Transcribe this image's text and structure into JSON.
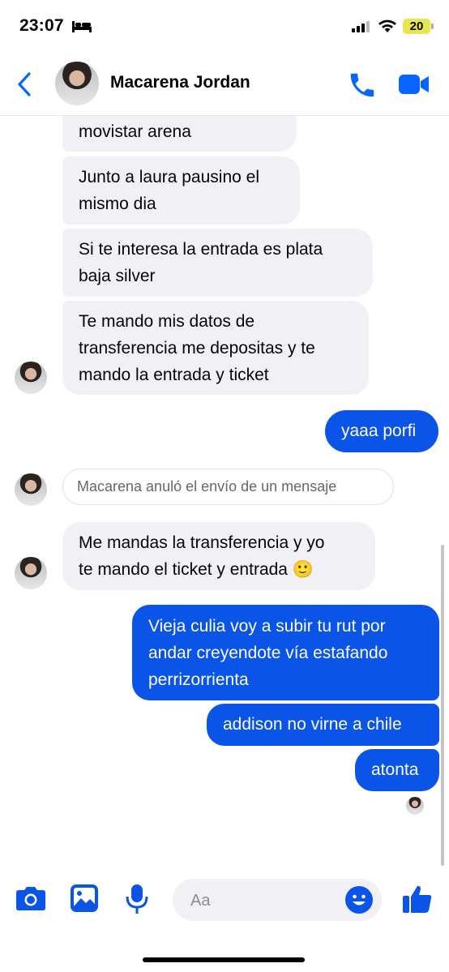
{
  "status_bar": {
    "time": "23:07",
    "battery": "20"
  },
  "header": {
    "contact_name": "Macarena Jordan"
  },
  "messages": [
    {
      "side": "in",
      "lines": [
        "movistar arena"
      ]
    },
    {
      "side": "in",
      "lines": [
        "Junto a laura pausino el",
        "mismo dia"
      ]
    },
    {
      "side": "in",
      "lines": [
        "Si te interesa la entrada es plata",
        "baja silver"
      ]
    },
    {
      "side": "in",
      "lines": [
        "Te mando mis datos de",
        "transferencia me depositas y te",
        "mando la entrada y ticket"
      ]
    },
    {
      "side": "out",
      "lines": [
        "yaaa porfi"
      ]
    },
    {
      "side": "system",
      "lines": [
        "Macarena anuló el envío de un mensaje"
      ]
    },
    {
      "side": "in",
      "lines": [
        "Me mandas la transferencia y yo",
        "te mando el ticket y entrada 🙂"
      ]
    },
    {
      "side": "out",
      "lines": [
        "Vieja culia voy a subir tu rut por",
        "andar creyendote vía estafando",
        "perrizorrienta"
      ]
    },
    {
      "side": "out",
      "lines": [
        "addison no virne a chile"
      ]
    },
    {
      "side": "out",
      "lines": [
        "atonta"
      ]
    }
  ],
  "composer": {
    "placeholder": "Aa"
  },
  "colors": {
    "accent": "#0a55e8",
    "incoming_bubble": "#f0f0f5",
    "header_icons": "#0866ff"
  },
  "icons": [
    "back-chevron-icon",
    "phone-icon",
    "video-camera-icon",
    "camera-icon",
    "gallery-icon",
    "microphone-icon",
    "emoji-icon",
    "thumbs-up-icon"
  ]
}
